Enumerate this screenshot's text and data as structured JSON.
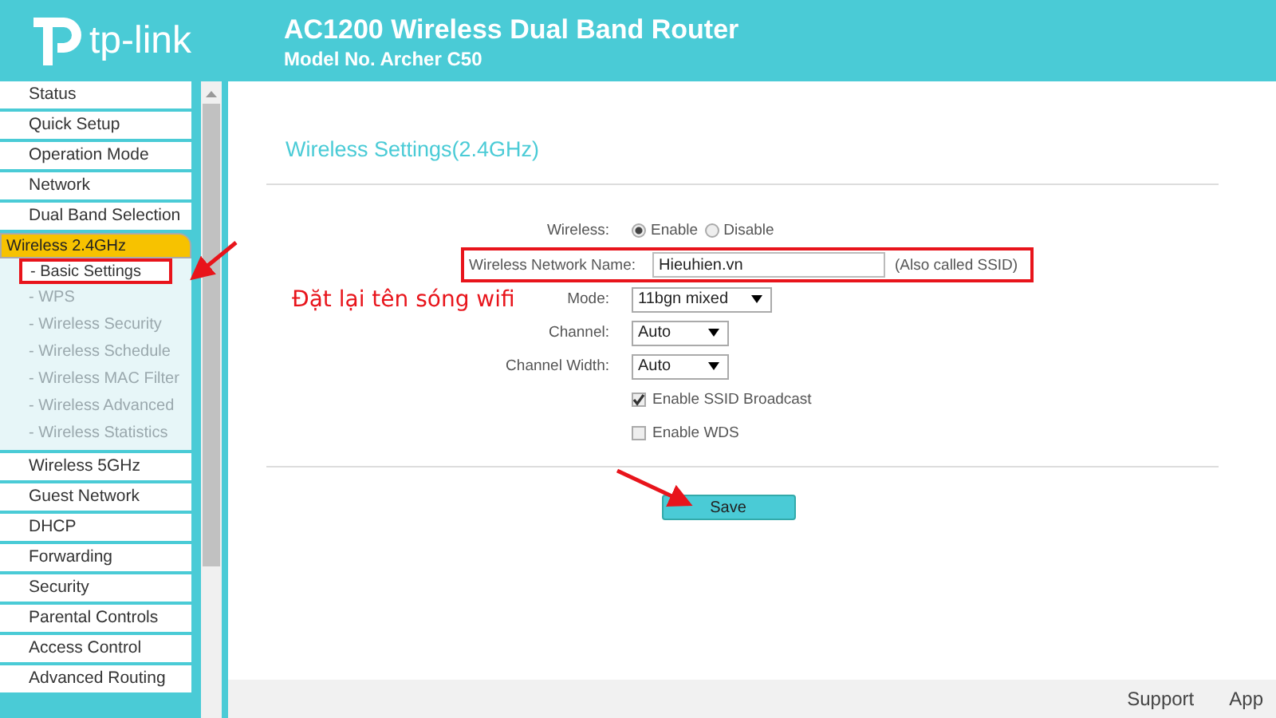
{
  "header": {
    "logo_text": "tp-link",
    "title": "AC1200 Wireless Dual Band Router",
    "model": "Model No. Archer C50"
  },
  "sidebar": {
    "items": [
      {
        "label": "Status",
        "selected": false
      },
      {
        "label": "Quick Setup",
        "selected": false
      },
      {
        "label": "Operation Mode",
        "selected": false
      },
      {
        "label": "Network",
        "selected": false
      },
      {
        "label": "Dual Band Selection",
        "selected": false
      },
      {
        "label": "Wireless 2.4GHz",
        "selected": true,
        "expanded": true,
        "children": [
          {
            "label": "- Basic Settings",
            "selected": true,
            "highlighted": true
          },
          {
            "label": "- WPS",
            "selected": false,
            "highlighted": false
          },
          {
            "label": "- Wireless Security",
            "selected": false,
            "highlighted": false
          },
          {
            "label": "- Wireless Schedule",
            "selected": false,
            "highlighted": false
          },
          {
            "label": "- Wireless MAC Filter",
            "selected": false,
            "highlighted": false
          },
          {
            "label": "- Wireless Advanced",
            "selected": false,
            "highlighted": false
          },
          {
            "label": "- Wireless Statistics",
            "selected": false,
            "highlighted": false
          }
        ]
      },
      {
        "label": "Wireless 5GHz",
        "selected": false
      },
      {
        "label": "Guest Network",
        "selected": false
      },
      {
        "label": "DHCP",
        "selected": false
      },
      {
        "label": "Forwarding",
        "selected": false
      },
      {
        "label": "Security",
        "selected": false
      },
      {
        "label": "Parental Controls",
        "selected": false
      },
      {
        "label": "Access Control",
        "selected": false
      },
      {
        "label": "Advanced Routing",
        "selected": false
      }
    ]
  },
  "content": {
    "title": "Wireless Settings(2.4GHz)",
    "rows": [
      {
        "kind": "radio",
        "label": "Wireless:",
        "highlighted": false,
        "options": [
          {
            "label": "Enable",
            "selected": true
          },
          {
            "label": "Disable",
            "selected": false
          }
        ]
      },
      {
        "kind": "text",
        "label": "Wireless Network Name:",
        "highlighted": true,
        "value": "Hieuhien.vn",
        "note": "(Also called SSID)"
      },
      {
        "kind": "select",
        "label": "Mode:",
        "highlighted": false,
        "value": "11bgn mixed"
      },
      {
        "kind": "select",
        "label": "Channel:",
        "highlighted": false,
        "value": "Auto"
      },
      {
        "kind": "select",
        "label": "Channel Width:",
        "highlighted": false,
        "value": "Auto"
      },
      {
        "kind": "checkbox",
        "label": "Enable SSID Broadcast",
        "checked": true
      },
      {
        "kind": "checkbox",
        "label": "Enable WDS",
        "checked": false
      }
    ],
    "save_button": "Save"
  },
  "annotation": {
    "text": "Đặt lại tên sóng wifi"
  },
  "footer": {
    "links": [
      "Support",
      "App"
    ]
  }
}
